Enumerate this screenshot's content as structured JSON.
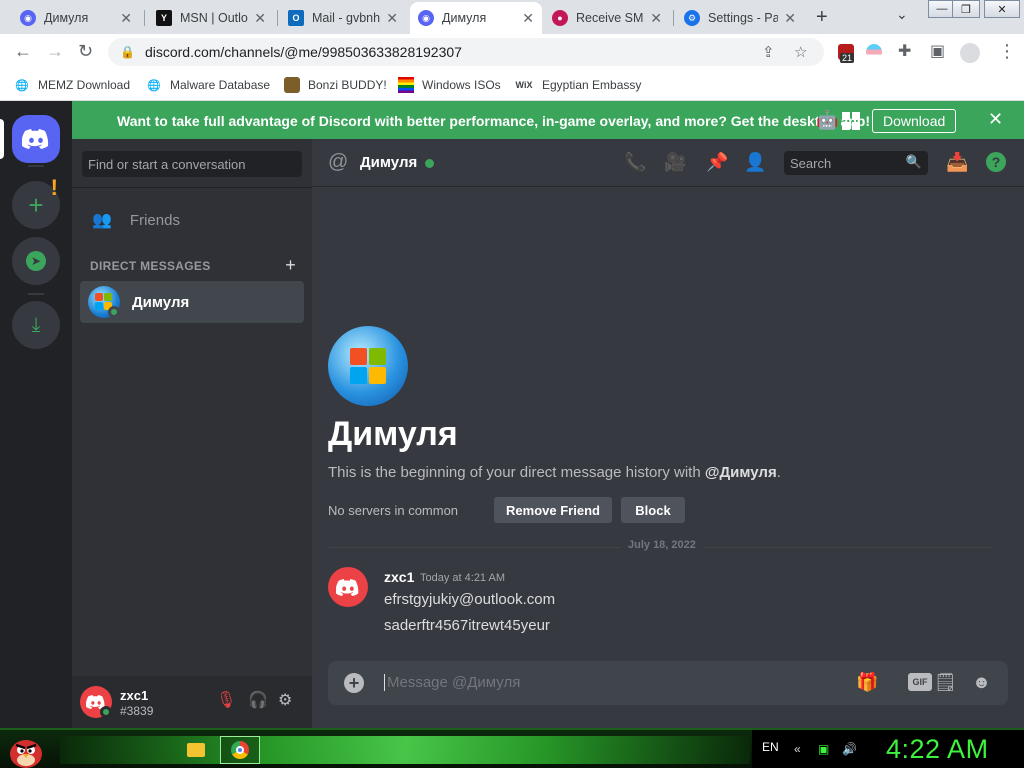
{
  "browser": {
    "tabs": [
      {
        "title": "Димуля",
        "favicon_color": "#5865f2",
        "active": false
      },
      {
        "title": "MSN | Outlook",
        "favicon_color": "#111111",
        "active": false
      },
      {
        "title": "Mail - gvbnhj",
        "favicon_color": "#0f6cbd",
        "active": false
      },
      {
        "title": "Димуля",
        "favicon_color": "#5865f2",
        "active": true
      },
      {
        "title": "Receive SMS",
        "favicon_color": "#c2185b",
        "active": false
      },
      {
        "title": "Settings - Pa",
        "favicon_color": "#1a73e8",
        "active": false
      }
    ],
    "url": "discord.com/channels/@me/998503633828192307",
    "extension_badge": "21",
    "bookmarks": [
      {
        "label": "MEMZ Download",
        "icon": "globe-icon"
      },
      {
        "label": "Malware Database",
        "icon": "globe-icon"
      },
      {
        "label": "Bonzi BUDDY!",
        "icon": "bonzi-icon"
      },
      {
        "label": "Windows ISOs",
        "icon": "rainbow-flag-icon"
      },
      {
        "label": "Egyptian Embassy",
        "icon": "wix-icon"
      }
    ]
  },
  "banner": {
    "message": "Want to take full advantage of Discord with better performance, in-game overlay, and more? Get the desktop app!",
    "download_label": "Download"
  },
  "sidebar": {
    "search_placeholder": "Find or start a conversation",
    "friends_label": "Friends",
    "direct_messages_header": "DIRECT MESSAGES",
    "dms": [
      {
        "name": "Димуля",
        "status": "online"
      }
    ]
  },
  "user": {
    "name": "zxc1",
    "tag": "#3839"
  },
  "chat": {
    "channel_name": "Димуля",
    "search_placeholder": "Search",
    "intro_title": "Димуля",
    "intro_text": "This is the beginning of your direct message history with ",
    "intro_mention": "@Димуля",
    "intro_end": ".",
    "no_servers": "No servers in common",
    "remove_friend_label": "Remove Friend",
    "block_label": "Block",
    "date_divider": "July 18, 2022",
    "messages": [
      {
        "author": "zxc1",
        "timestamp": "Today at 4:21 AM",
        "lines": [
          "efrstgyjukiy@outlook.com",
          "saderftr4567itrewt45yeur"
        ]
      }
    ],
    "composer_placeholder": "Message @Димуля"
  },
  "taskbar": {
    "language": "EN",
    "clock": "4:22 AM"
  },
  "colors": {
    "blurple": "#5865f2",
    "green": "#3ba55c",
    "red": "#ed4245",
    "clock_green": "#3ef33e"
  }
}
